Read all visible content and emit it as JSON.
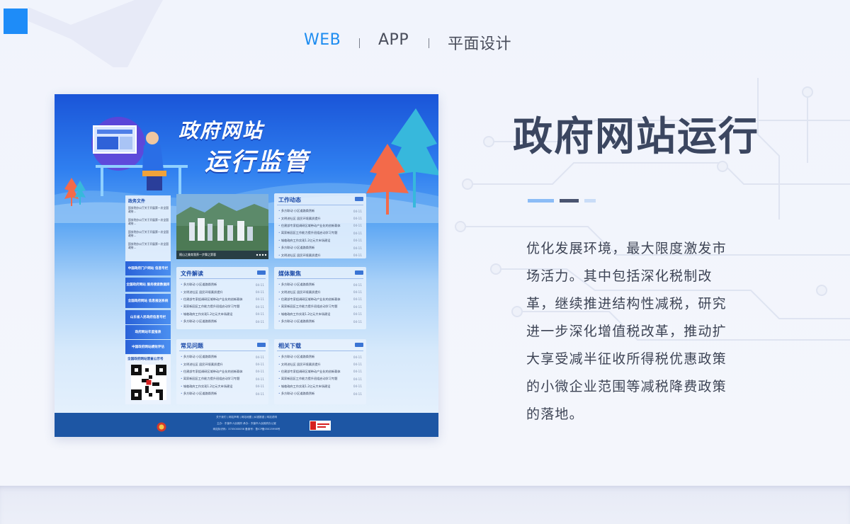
{
  "nav": {
    "items": [
      {
        "label": "WEB",
        "active": true
      },
      {
        "label": "APP",
        "active": false
      },
      {
        "label": "平面设计",
        "active": false
      }
    ],
    "separator": "|"
  },
  "mockup": {
    "banner_title_1": "政府网站",
    "banner_title_2": "运行监管",
    "left_column": {
      "title": "政务文件",
      "items": [
        "国务院办公厅关于开展第一次全国政府...",
        "国务院办公厅关于开展第一次全国政府...",
        "国务院办公厅关于开展第一次全国政府...",
        "国务院办公厅关于开展第一次全国政府..."
      ]
    },
    "photo_caption": "随山之美育我养一步舞之第蓉",
    "side_banners": [
      "中国政府门户网站 信息专栏",
      "全国政府网站 服务搜索数据库",
      "全国政府网站 信息报送系统",
      "山东省人民政府信息专栏",
      "政府网站年度报表",
      "中国政府网站绩效评估"
    ],
    "qr_title": "全国政府网站普查公示号",
    "panels": [
      {
        "title": "工作动态",
        "rows": [
          {
            "t": "多方联动 小区道路焕然新",
            "d": "04-11"
          },
          {
            "t": "文明进社区 居民环境素质提升",
            "d": "04-11"
          },
          {
            "t": "住建部专家组调研区域带动产业化的创新载体",
            "d": "04-11"
          },
          {
            "t": "离家新园区工作能力提升班组启动学习专题",
            "d": "04-11"
          },
          {
            "t": "城临政府工作实现1.2亿元大市场建设",
            "d": "04-11"
          },
          {
            "t": "多方联动 小区道路焕然新",
            "d": "04-11"
          },
          {
            "t": "文明进社区 居民环境素质提升",
            "d": "04-11"
          }
        ]
      },
      {
        "title": "文件解读",
        "rows": [
          {
            "t": "多方联动 小区道路焕然新",
            "d": "04-11"
          },
          {
            "t": "文明进社区 居民环境素质提升",
            "d": "04-11"
          },
          {
            "t": "住建部专家组调研区域带动产业化的创新载体",
            "d": "04-11"
          },
          {
            "t": "离家新园区工作能力提升班组启动学习专题",
            "d": "04-11"
          },
          {
            "t": "城临政府工作实现1.2亿元大市场建设",
            "d": "04-11"
          },
          {
            "t": "多方联动 小区道路焕然新",
            "d": "04-11"
          }
        ]
      },
      {
        "title": "媒体聚焦",
        "rows": [
          {
            "t": "多方联动 小区道路焕然新",
            "d": "04-11"
          },
          {
            "t": "文明进社区 居民环境素质提升",
            "d": "04-11"
          },
          {
            "t": "住建部专家组调研区域带动产业化的创新载体",
            "d": "04-11"
          },
          {
            "t": "离家新园区工作能力提升班组启动学习专题",
            "d": "04-11"
          },
          {
            "t": "城临政府工作实现1.2亿元大市场建设",
            "d": "04-11"
          },
          {
            "t": "多方联动 小区道路焕然新",
            "d": "04-11"
          }
        ]
      },
      {
        "title": "常见问题",
        "rows": [
          {
            "t": "多方联动 小区道路焕然新",
            "d": "04-11"
          },
          {
            "t": "文明进社区 居民环境素质提升",
            "d": "04-11"
          },
          {
            "t": "住建部专家组调研区域带动产业化的创新载体",
            "d": "04-11"
          },
          {
            "t": "离家新园区工作能力提升班组启动学习专题",
            "d": "04-11"
          },
          {
            "t": "城临政府工作实现1.2亿元大市场建设",
            "d": "04-11"
          },
          {
            "t": "多方联动 小区道路焕然新",
            "d": "04-11"
          }
        ]
      },
      {
        "title": "相关下载",
        "rows": [
          {
            "t": "多方联动 小区道路焕然新",
            "d": "04-11"
          },
          {
            "t": "文明进社区 居民环境素质提升",
            "d": "04-11"
          },
          {
            "t": "住建部专家组调研区域带动产业化的创新载体",
            "d": "04-11"
          },
          {
            "t": "离家新园区工作能力提升班组启动学习专题",
            "d": "04-11"
          },
          {
            "t": "城临政府工作实现1.2亿元大市场建设",
            "d": "04-11"
          },
          {
            "t": "多方联动 小区道路焕然新",
            "d": "04-11"
          }
        ]
      }
    ],
    "footer": {
      "links": "关于我们 | 网站声明 | 网站地图 | 纠错报错 | 网站说明",
      "line2": "主办：东营市人民政府 承办：东营市人民政府办公室",
      "line3": "网站标识码：3705000056   备案号：鲁ICP备05025998号"
    }
  },
  "headline": "政府网站运行",
  "body_text": "优化发展环境，最大限度激发市场活力。其中包括深化税制改革，继续推进结构性减税，研究进一步深化增值税改革，推动扩大享受减半征收所得税优惠政策的小微企业范围等减税降费政策的落地。",
  "colors": {
    "accent": "#1d8cf0",
    "headline": "#3b4660",
    "dash_1": "#8bbcf6",
    "dash_2": "#4a5470",
    "dash_3": "#c9dcf7"
  }
}
